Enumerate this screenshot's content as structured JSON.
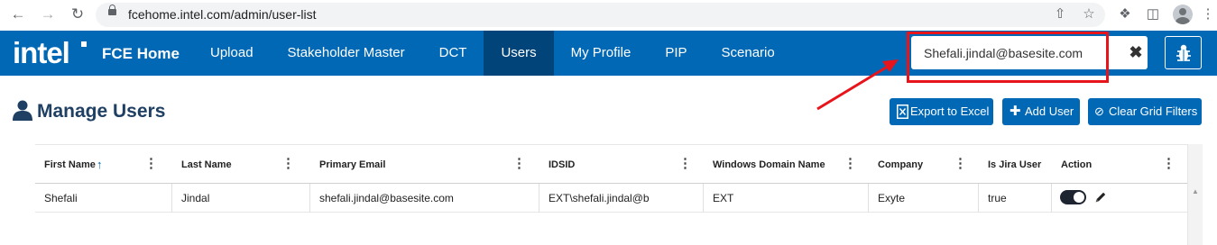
{
  "browser": {
    "url": "fcehome.intel.com/admin/user-list"
  },
  "header": {
    "logo": "intel",
    "title": "FCE Home",
    "nav": [
      {
        "label": "Upload"
      },
      {
        "label": "Stakeholder Master"
      },
      {
        "label": "DCT"
      },
      {
        "label": "Users",
        "active": true
      },
      {
        "label": "My Profile"
      },
      {
        "label": "PIP"
      },
      {
        "label": "Scenario"
      }
    ],
    "search_value": "Shefali.jindal@basesite.com"
  },
  "page": {
    "title": "Manage Users",
    "buttons": {
      "export": "Export to Excel",
      "add_user": "Add User",
      "clear_filters": "Clear Grid Filters"
    }
  },
  "grid": {
    "columns": [
      {
        "label": "First Name",
        "sorted": "asc"
      },
      {
        "label": "Last Name"
      },
      {
        "label": "Primary Email"
      },
      {
        "label": "IDSID"
      },
      {
        "label": "Windows Domain Name"
      },
      {
        "label": "Company"
      },
      {
        "label": "Is Jira User"
      },
      {
        "label": "Action"
      }
    ],
    "rows": [
      {
        "first_name": "Shefali",
        "last_name": "Jindal",
        "email": "shefali.jindal@basesite.com",
        "idsid": "EXT\\shefali.jindal@b",
        "domain": "EXT",
        "company": "Exyte",
        "jira": "true",
        "active": true
      }
    ]
  },
  "colors": {
    "brand": "#0068b5",
    "active_nav": "#00447a",
    "annotation": "#e8141b",
    "title": "#1f3f63"
  }
}
